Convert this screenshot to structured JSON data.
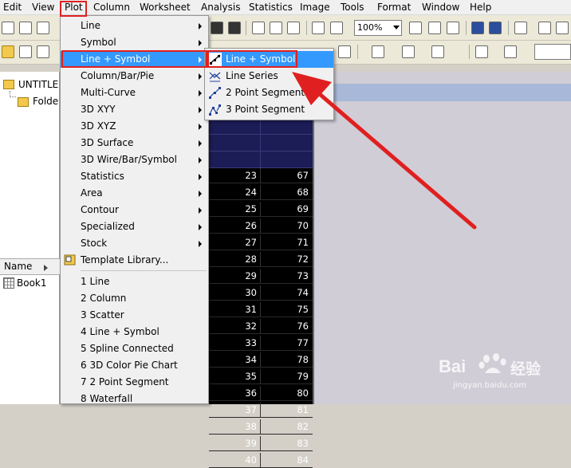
{
  "menubar": {
    "items": [
      "Edit",
      "View",
      "Plot",
      "Column",
      "Worksheet",
      "Analysis",
      "Statistics",
      "Image",
      "Tools",
      "Format",
      "Window",
      "Help"
    ]
  },
  "toolbar": {
    "zoom_value": "100%"
  },
  "project_tree": {
    "root": "UNTITLE",
    "folder": "Folde"
  },
  "project_list": {
    "header_name": "Name",
    "book": "Book1"
  },
  "plot_menu": {
    "items": [
      {
        "label": "Line",
        "submenu": true
      },
      {
        "label": "Symbol",
        "submenu": true
      },
      {
        "label": "Line + Symbol",
        "submenu": true
      },
      {
        "label": "Column/Bar/Pie",
        "submenu": true
      },
      {
        "label": "Multi-Curve",
        "submenu": true
      },
      {
        "label": "3D XYY",
        "submenu": true
      },
      {
        "label": "3D XYZ",
        "submenu": true
      },
      {
        "label": "3D Surface",
        "submenu": true
      },
      {
        "label": "3D Wire/Bar/Symbol",
        "submenu": true
      },
      {
        "label": "Statistics",
        "submenu": true
      },
      {
        "label": "Area",
        "submenu": true
      },
      {
        "label": "Contour",
        "submenu": true
      },
      {
        "label": "Specialized",
        "submenu": true
      },
      {
        "label": "Stock",
        "submenu": true
      },
      {
        "label": "Template Library...",
        "submenu": false
      }
    ],
    "recent": [
      "1 Line",
      "2 Column",
      "3 Scatter",
      "4 Line + Symbol",
      "5 Spline Connected",
      "6 3D Color Pie Chart",
      "7 2 Point Segment",
      "8 Waterfall"
    ]
  },
  "submenu": {
    "items": [
      "Line + Symbol",
      "Line Series",
      "2 Point Segment",
      "3 Point Segment"
    ]
  },
  "worksheet": {
    "rows": [
      [
        "23",
        "67"
      ],
      [
        "24",
        "68"
      ],
      [
        "25",
        "69"
      ],
      [
        "26",
        "70"
      ],
      [
        "27",
        "71"
      ],
      [
        "28",
        "72"
      ],
      [
        "29",
        "73"
      ],
      [
        "30",
        "74"
      ],
      [
        "31",
        "75"
      ],
      [
        "32",
        "76"
      ],
      [
        "33",
        "77"
      ],
      [
        "34",
        "78"
      ],
      [
        "35",
        "79"
      ],
      [
        "36",
        "80"
      ],
      [
        "37",
        "81"
      ],
      [
        "38",
        "82"
      ],
      [
        "39",
        "83"
      ],
      [
        "40",
        "84"
      ]
    ]
  },
  "watermark": {
    "brand": "Bai",
    "brand_cn": "经验",
    "url": "jingyan.baidu.com"
  },
  "colors": {
    "highlight": "#3399ff",
    "annotation_red": "#e02020",
    "worksheet_bg": "#000000"
  }
}
